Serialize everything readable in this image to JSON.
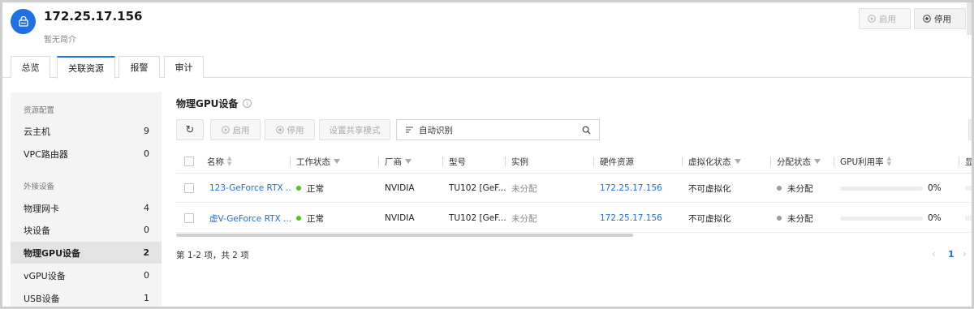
{
  "header": {
    "title": "172.25.17.156",
    "subtitle": "暂无简介",
    "enable_label": "启用",
    "disable_label": "停用"
  },
  "tabs": [
    {
      "label": "总览",
      "active": false
    },
    {
      "label": "关联资源",
      "active": true
    },
    {
      "label": "报警",
      "active": false
    },
    {
      "label": "审计",
      "active": false
    }
  ],
  "sidebar": {
    "group1": "资源配置",
    "group2": "外接设备",
    "items": [
      {
        "label": "云主机",
        "count": "9"
      },
      {
        "label": "VPC路由器",
        "count": "0"
      },
      {
        "label": "物理网卡",
        "count": "4"
      },
      {
        "label": "块设备",
        "count": "0"
      },
      {
        "label": "物理GPU设备",
        "count": "2",
        "active": true
      },
      {
        "label": "vGPU设备",
        "count": "0"
      },
      {
        "label": "USB设备",
        "count": "1"
      }
    ]
  },
  "section": {
    "title": "物理GPU设备",
    "info_icon": "i"
  },
  "toolbar": {
    "refresh_icon": "↻",
    "enable_label": "启用",
    "disable_label": "停用",
    "share_mode_label": "设置共享模式",
    "search_value": "自动识别",
    "search_icon": "⌕"
  },
  "table": {
    "columns": [
      "名称",
      "工作状态",
      "厂商",
      "型号",
      "实例",
      "硬件资源",
      "虚拟化状态",
      "分配状态",
      "GPU利用率",
      "显"
    ],
    "rows": [
      {
        "name": "123-GeForce RTX ...",
        "status": "正常",
        "vendor": "NVIDIA",
        "model": "TU102 [GeF...",
        "instance": "未分配",
        "hardware": "172.25.17.156",
        "virt": "不可虚拟化",
        "alloc": "未分配",
        "gpu_util": "0%",
        "gpu_util_value": 0
      },
      {
        "name": "虚V-GeForce RTX ...",
        "status": "正常",
        "vendor": "NVIDIA",
        "model": "TU102 [GeF...",
        "instance": "未分配",
        "hardware": "172.25.17.156",
        "virt": "不可虚拟化",
        "alloc": "未分配",
        "gpu_util": "0%",
        "gpu_util_value": 0
      }
    ]
  },
  "pagination": {
    "summary": "第 1-2 项，共 2 项",
    "prev": "‹",
    "page": "1",
    "next": "›"
  },
  "colors": {
    "accent": "#1f6fe5",
    "status_ok": "#52c41a",
    "status_idle": "#999999"
  }
}
